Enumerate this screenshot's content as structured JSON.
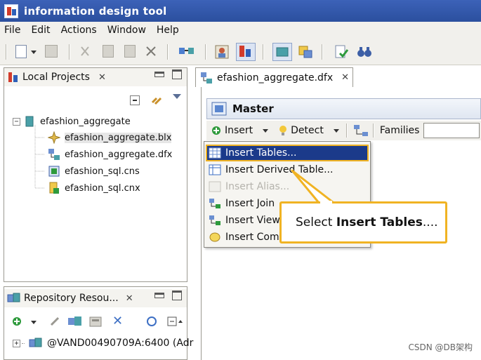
{
  "window": {
    "title": "information design tool"
  },
  "menubar": {
    "items": [
      "File",
      "Edit",
      "Actions",
      "Window",
      "Help"
    ]
  },
  "local_projects": {
    "tab_label": "Local Projects",
    "tree": {
      "root": "efashion_aggregate",
      "children": [
        "efashion_aggregate.blx",
        "efashion_aggregate.dfx",
        "efashion_sql.cns",
        "efashion_sql.cnx"
      ]
    }
  },
  "repository": {
    "tab_label": "Repository Resou...",
    "tree_root": "@VAND00490709A:6400 (Adr"
  },
  "editor": {
    "tab_label": "efashion_aggregate.dfx",
    "section_title": "Master",
    "toolbar": {
      "insert": "Insert",
      "detect": "Detect",
      "families": "Families"
    }
  },
  "context_menu": {
    "items": [
      {
        "label": "Insert Tables...",
        "state": "selected"
      },
      {
        "label": "Insert Derived Table...",
        "state": "normal"
      },
      {
        "label": "Insert Alias...",
        "state": "disabled"
      },
      {
        "label": "Insert Join",
        "state": "normal"
      },
      {
        "label": "Insert View",
        "state": "normal"
      },
      {
        "label": "Insert Com",
        "state": "normal"
      }
    ]
  },
  "callout": {
    "prefix": "Select ",
    "bold": "Insert Tables",
    "suffix": "...."
  },
  "watermark": "CSDN @DB架构",
  "colors": {
    "title_bar": "#2b4f9e",
    "highlight": "#1b3a8a",
    "callout_border": "#f0b323"
  }
}
